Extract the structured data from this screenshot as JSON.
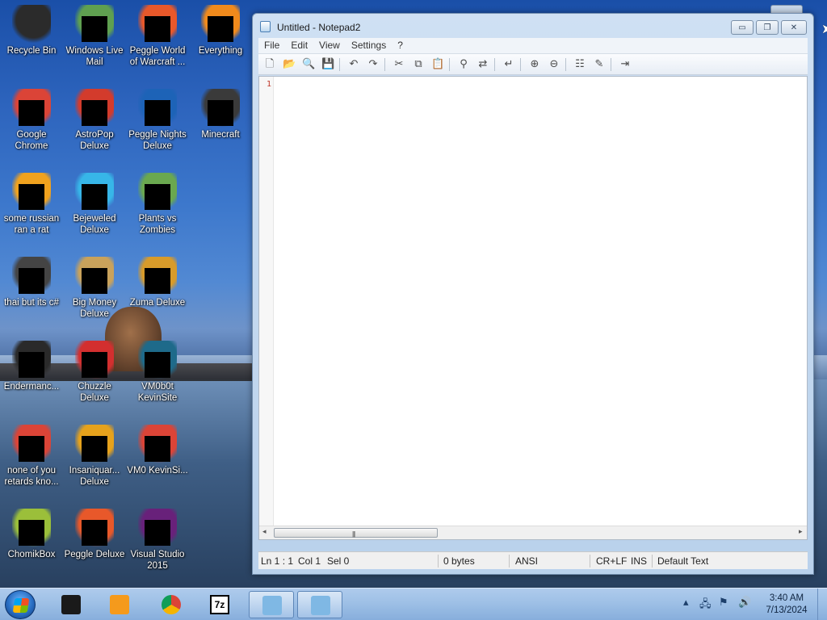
{
  "desktop": {
    "icons": [
      {
        "label": "Recycle Bin",
        "glyph": "recycle-bin-icon",
        "color": "#2b2b2b"
      },
      {
        "label": "Windows Live Mail",
        "glyph": "windows-live-mail-icon",
        "color": "#5fa050"
      },
      {
        "label": "Peggle World of Warcraft ...",
        "glyph": "peggle-world-of-warcraft-icon",
        "color": "#e8582a"
      },
      {
        "label": "Everything",
        "glyph": "everything-search-icon",
        "color": "#f08a1c"
      },
      {
        "label": "Google Chrome",
        "glyph": "google-chrome-icon",
        "color": "#db4437"
      },
      {
        "label": "AstroPop Deluxe",
        "glyph": "astropop-icon",
        "color": "#d33b2c"
      },
      {
        "label": "Peggle Nights Deluxe",
        "glyph": "peggle-nights-icon",
        "color": "#1d63b7"
      },
      {
        "label": "Minecraft",
        "glyph": "minecraft-icon",
        "color": "#3a3a3a"
      },
      {
        "label": "some russian ran a rat",
        "glyph": "rat-app-icon",
        "color": "#f0a21e"
      },
      {
        "label": "Bejeweled Deluxe",
        "glyph": "bejeweled-icon",
        "color": "#37b6e8"
      },
      {
        "label": "Plants vs Zombies",
        "glyph": "plants-vs-zombies-icon",
        "color": "#6aa84f"
      },
      {
        "label": "thai but its c#",
        "glyph": "shortcut-stack-icon",
        "color": "#444444"
      },
      {
        "label": "Big Money Deluxe",
        "glyph": "big-money-icon",
        "color": "#c9a25b"
      },
      {
        "label": "Zuma Deluxe",
        "glyph": "zuma-icon",
        "color": "#d89b2a"
      },
      {
        "label": "Endermanc...",
        "glyph": "endermanc-icon",
        "color": "#2a2a2a"
      },
      {
        "label": "Chuzzle Deluxe",
        "glyph": "chuzzle-icon",
        "color": "#d32f2f"
      },
      {
        "label": "VM0b0t KevinSite",
        "glyph": "vm0b0t-icon",
        "color": "#1e6a8a"
      },
      {
        "label": "none of you retards kno...",
        "glyph": "chrome-shortcut-icon",
        "color": "#db4437"
      },
      {
        "label": "Insaniquar... Deluxe",
        "glyph": "insaniquarium-icon",
        "color": "#e6a21c"
      },
      {
        "label": "VM0 KevinSi...",
        "glyph": "chrome-shortcut-icon",
        "color": "#db4437"
      },
      {
        "label": "ChomikBox",
        "glyph": "chomikbox-icon",
        "color": "#9bbf3a"
      },
      {
        "label": "Peggle Deluxe",
        "glyph": "peggle-deluxe-icon",
        "color": "#e8582a"
      },
      {
        "label": "Visual Studio 2015",
        "glyph": "visual-studio-icon",
        "color": "#68217a"
      }
    ]
  },
  "window": {
    "title": "Untitled - Notepad2",
    "minimize_glyph": "▭",
    "maximize_glyph": "❐",
    "close_glyph": "✕",
    "menu": [
      "File",
      "Edit",
      "View",
      "Settings",
      "?"
    ],
    "toolbar": [
      {
        "name": "new-file-icon",
        "glyph": "🗋"
      },
      {
        "name": "open-file-icon",
        "glyph": "📂"
      },
      {
        "name": "browse-icon",
        "glyph": "🔍"
      },
      {
        "name": "save-icon",
        "glyph": "💾"
      },
      {
        "name": "undo-icon",
        "glyph": "↶"
      },
      {
        "name": "redo-icon",
        "glyph": "↷"
      },
      {
        "name": "cut-icon",
        "glyph": "✂"
      },
      {
        "name": "copy-icon",
        "glyph": "⧉"
      },
      {
        "name": "paste-icon",
        "glyph": "📋"
      },
      {
        "name": "find-icon",
        "glyph": "⚲"
      },
      {
        "name": "replace-icon",
        "glyph": "⇄"
      },
      {
        "name": "word-wrap-icon",
        "glyph": "↵"
      },
      {
        "name": "zoom-in-icon",
        "glyph": "⊕"
      },
      {
        "name": "zoom-out-icon",
        "glyph": "⊖"
      },
      {
        "name": "scheme-icon",
        "glyph": "☷"
      },
      {
        "name": "customize-scheme-icon",
        "glyph": "✎"
      },
      {
        "name": "exit-icon",
        "glyph": "⇥"
      }
    ],
    "editor": {
      "line_number": "1"
    },
    "scrollbar": {
      "left_arrow": "◂",
      "right_arrow": "▸",
      "grip": "|||"
    },
    "status": {
      "position": "Ln 1 : 1",
      "column": "Col 1",
      "selection": "Sel 0",
      "size": "0 bytes",
      "encoding": "ANSI",
      "line_endings": "CR+LF",
      "mode": "INS",
      "scheme": "Default Text"
    }
  },
  "taskbar": {
    "items": [
      {
        "name": "taskbar-app-black-icon",
        "color": "#1a1a1a",
        "active": false
      },
      {
        "name": "taskbar-media-player-icon",
        "color": "#f59a1c",
        "active": false
      },
      {
        "name": "taskbar-chrome-icon",
        "color": "#db4437",
        "active": false
      },
      {
        "name": "taskbar-7zip-icon",
        "color": "#000000",
        "label": "7z",
        "active": false
      },
      {
        "name": "taskbar-notepad2-icon",
        "color": "#7fb8e4",
        "active": true
      },
      {
        "name": "taskbar-notepad2-icon-2",
        "color": "#7fb8e4",
        "active": true
      }
    ],
    "tray_glyphs": {
      "expand": "▴",
      "network": "🖧",
      "action": "⚑",
      "volume": "🔊"
    },
    "clock": {
      "time": "3:40 AM",
      "date": "7/13/2024"
    }
  }
}
